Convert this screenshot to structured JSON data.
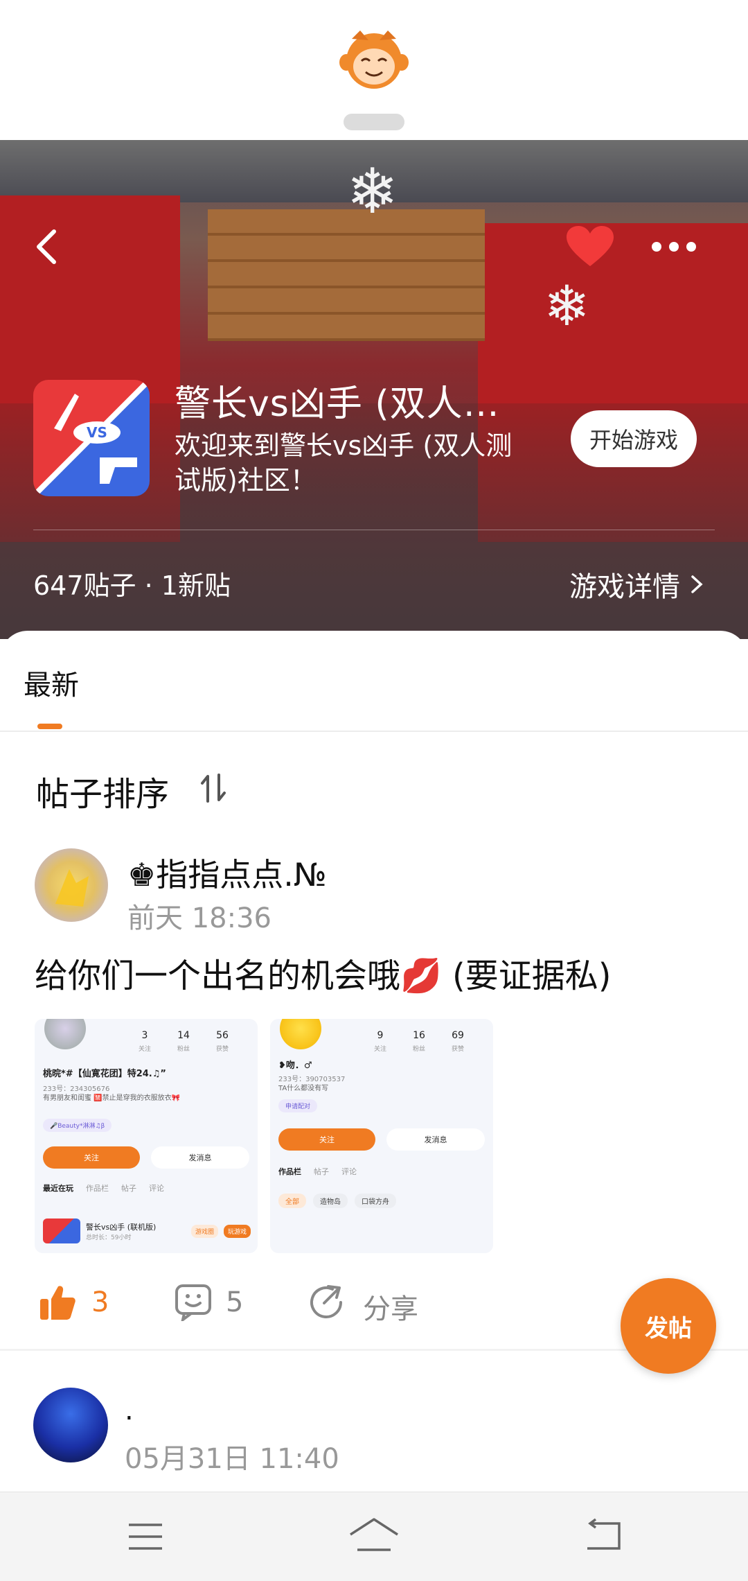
{
  "hero": {
    "title": "警长vs凶手 (双人…",
    "description": "欢迎来到警长vs凶手 (双人测试版)社区！",
    "start_button": "开始游戏",
    "stats": "647贴子 · 1新贴",
    "details_link": "游戏详情",
    "icon_badge": "VS"
  },
  "tabs": {
    "latest": "最新"
  },
  "sort": {
    "label": "帖子排序"
  },
  "posts": [
    {
      "username": "♚指指点点.№",
      "time": "前天 18:36",
      "text": "给你们一个出名的机会哦💋 (要证据私)",
      "likes": "3",
      "comments": "5",
      "share": "分享",
      "screenshots": [
        {
          "stats": [
            {
              "value": "3",
              "label": "关注"
            },
            {
              "value": "14",
              "label": "粉丝"
            },
            {
              "value": "56",
              "label": "获赞"
            }
          ],
          "name": "桃晥*#【仙寛花团】特24.♫”",
          "id": "233号：234305676",
          "bio": "有男朋友和闺蜜 \n 🈲禁止是穿我的衣服放衣🎀",
          "tag": "🎤Beauty*淋淋♫β",
          "follow": "关注",
          "message": "发消息",
          "tabs": [
            "最近在玩",
            "作品栏",
            "帖子",
            "评论"
          ],
          "game_name": "警长vs凶手 (联机版)",
          "game_meta": "总时长：59小时",
          "game_badge": "游戏圈",
          "game_play": "玩游戏"
        },
        {
          "stats": [
            {
              "value": "9",
              "label": "关注"
            },
            {
              "value": "16",
              "label": "粉丝"
            },
            {
              "value": "69",
              "label": "获赞"
            }
          ],
          "name": "❥吻．♂",
          "id": "233号：390703537",
          "bio": "TA什么都没有写",
          "tag": "申请配对",
          "follow": "关注",
          "message": "发消息",
          "tabs": [
            "作品栏",
            "帖子",
            "评论"
          ],
          "chips": [
            "全部",
            "造物岛",
            "口袋方舟"
          ]
        }
      ]
    },
    {
      "username": ".",
      "time": "05月31日 11:40"
    }
  ],
  "fab": {
    "label": "发帖"
  },
  "colors": {
    "accent": "#f07b22",
    "hero_red": "#b31f22",
    "icon_blue": "#3b67e0"
  },
  "icons": [
    "back-arrow",
    "heart",
    "more-dots",
    "sort",
    "thumb-up",
    "comment",
    "share",
    "menu",
    "home",
    "back"
  ]
}
